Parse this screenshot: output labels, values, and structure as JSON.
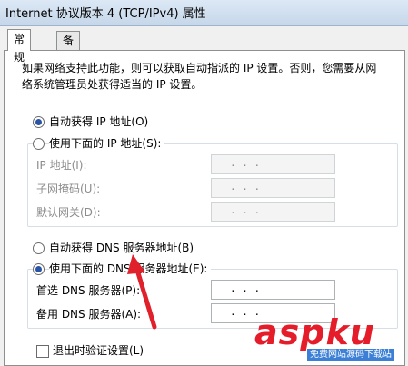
{
  "window": {
    "title": "Internet 协议版本 4 (TCP/IPv4) 属性"
  },
  "tabs": [
    {
      "label": "常规"
    },
    {
      "label": "备用配置"
    }
  ],
  "intro": "如果网络支持此功能，则可以获取自动指派的 IP 设置。否则，您需要从网络系统管理员处获得适当的 IP 设置。",
  "ip": {
    "auto_label": "自动获得 IP 地址(O)",
    "manual_label": "使用下面的 IP 地址(S):",
    "fields": [
      {
        "label": "IP 地址(I):",
        "value": ".   .   ."
      },
      {
        "label": "子网掩码(U):",
        "value": ".   .   ."
      },
      {
        "label": "默认网关(D):",
        "value": ".   .   ."
      }
    ]
  },
  "dns": {
    "auto_label": "自动获得 DNS 服务器地址(B)",
    "manual_label": "使用下面的 DNS 服务器地址(E):",
    "fields": [
      {
        "label": "首选 DNS 服务器(P):",
        "value": ".   .   ."
      },
      {
        "label": "备用 DNS 服务器(A):",
        "value": ".   .   ."
      }
    ]
  },
  "validate_label": "退出时验证设置(L)",
  "watermark": {
    "logo": "aspku",
    "tagline": "免费网站源码下载站"
  },
  "colors": {
    "accent": "#2a55a5",
    "arrow": "#e0202a",
    "watermark_red": "#e51d2a"
  }
}
